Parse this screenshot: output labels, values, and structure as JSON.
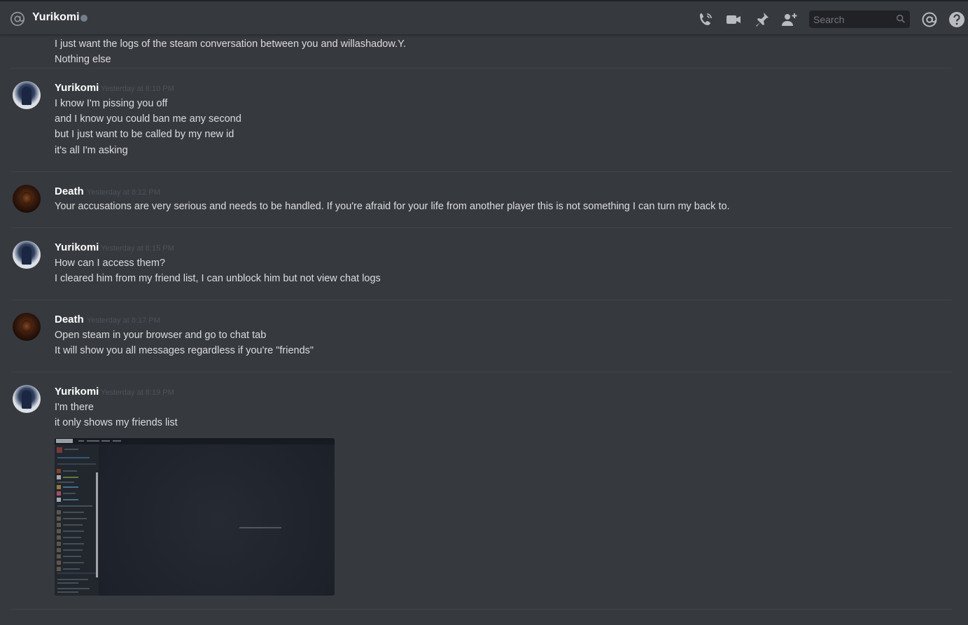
{
  "header": {
    "channel_name": "Yurikomi",
    "status": "offline",
    "search_placeholder": "Search",
    "icons": [
      "at-icon",
      "call-icon",
      "video-icon",
      "pin-icon",
      "add-friend-icon",
      "search-icon",
      "mention-icon",
      "help-icon"
    ]
  },
  "messages": [
    {
      "author": "",
      "timestamp": "",
      "lines": [
        "I just want the logs of the steam conversation between you and willashadow.Y.",
        "Nothing else"
      ]
    },
    {
      "author": "Yurikomi",
      "timestamp": "Yesterday at 8:10 PM",
      "lines": [
        "I know I'm pissing you off",
        "and I know you could ban me any second",
        "but I just want to be called by my new id",
        "it's all I'm asking"
      ]
    },
    {
      "author": "Death",
      "timestamp": "Yesterday at 8:12 PM",
      "lines": [
        "Your accusations are very serious and needs to be handled. If you're afraid for your life from another player this is not something I can turn my back to."
      ]
    },
    {
      "author": "Yurikomi",
      "timestamp": "Yesterday at 8:15 PM",
      "lines": [
        "How can I access them?",
        "I cleared him from my friend list, I can unblock him but not view chat logs"
      ]
    },
    {
      "author": "Death",
      "timestamp": "Yesterday at 8:17 PM",
      "lines": [
        "Open steam in your browser and go to chat tab",
        "It will show you all messages regardless if you're \"friends\""
      ]
    },
    {
      "author": "Yurikomi",
      "timestamp": "Yesterday at 8:19 PM",
      "lines": [
        "I'm there",
        "it only shows my friends list"
      ],
      "attachment": "steam-chat-screenshot"
    }
  ],
  "colors": {
    "background": "#36393e",
    "username": "#ffffff",
    "timestamp": "#4f535a",
    "text": "#dcddde",
    "status_offline": "#747f8d"
  }
}
